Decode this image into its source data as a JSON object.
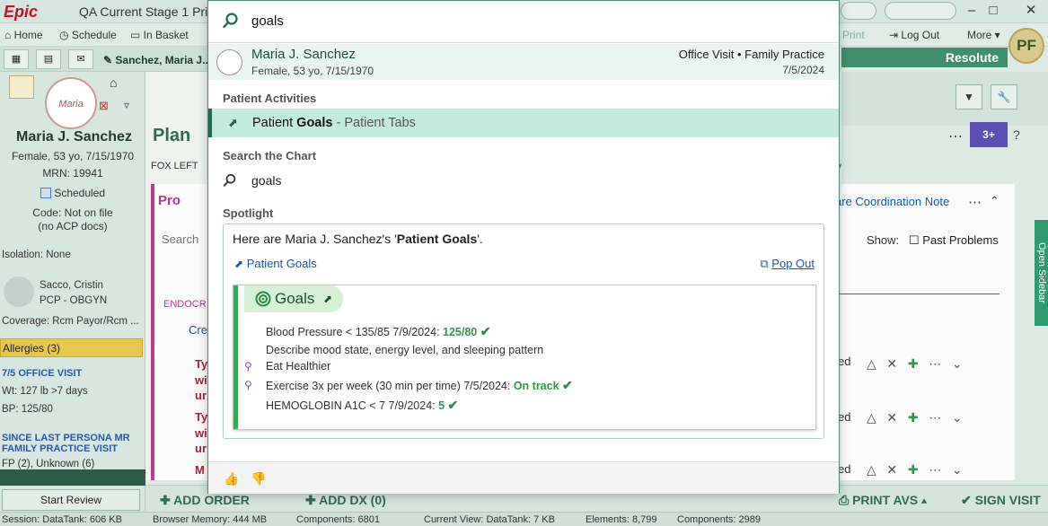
{
  "window": {
    "app_logo": "Epic",
    "title": "QA Current Stage 1 Prin"
  },
  "menubar": {
    "home": "Home",
    "schedule": "Schedule",
    "in_basket": "In Basket",
    "print": "Print",
    "log_out": "Log Out",
    "more": "More"
  },
  "user_initials": "PF",
  "patient_tab": "Sanchez, Maria J...",
  "resolute_label": "Resolute",
  "sidebar": {
    "name": "Maria J. Sanchez",
    "demographics": "Female, 53 yo, 7/15/1970",
    "mrn": "MRN: 19941",
    "scheduled": "Scheduled",
    "code_line1": "Code: Not on file",
    "code_line2": "(no ACP docs)",
    "isolation": "Isolation: None",
    "pcp_name": "Sacco, Cristin",
    "pcp_role": "PCP - OBGYN",
    "coverage": "Coverage: Rcm Payor/Rcm ...",
    "allergies": "Allergies (3)",
    "visit_header": "7/5 OFFICE VISIT",
    "weight": "Wt:  127 lb >7 days",
    "bp": "BP:  125/80",
    "since_line1": "SINCE LAST PERSONA MR",
    "since_line2": "FAMILY PRACTICE VISIT",
    "fp_line": "FP (2), Unknown (6)",
    "start_review": "Start Review"
  },
  "main": {
    "plan_title": "Plan",
    "fox_left": "FOX LEFT",
    "problem_partial": "Pro",
    "search_partial": "Search",
    "endocr_partial": "ENDOCR",
    "cre_partial": "Cre",
    "ty_partial": "Ty",
    "wi_partial": "wi",
    "ur_partial": "ur",
    "m_partial": "M",
    "care_coord": "are Coordination Note",
    "show_label": "Show:",
    "past_problems": "Past Problems",
    "open_sidebar": "Open Sidebar",
    "y_partial": "y",
    "ed_partial": "ed",
    "badge_count": "3+"
  },
  "bottombar": {
    "add_order": "ADD ORDER",
    "add_dx": "ADD DX (0)",
    "print_avs": "PRINT AVS",
    "sign_visit": "SIGN VISIT"
  },
  "statusbar": {
    "session": "Session:  DataTank: 606 KB",
    "browser_memory": "Browser Memory: 444 MB",
    "components": "Components: 6801",
    "current_view": "Current View:  DataTank: 7 KB",
    "elements": "Elements: 8,799",
    "components2": "Components: 2989"
  },
  "search": {
    "query": "goals",
    "patient": {
      "name": "Maria J. Sanchez",
      "details": "Female, 53 yo, 7/15/1970",
      "visit": "Office Visit • Family Practice",
      "date": "7/5/2024"
    },
    "patient_activities_label": "Patient Activities",
    "activity": {
      "prefix": "Patient ",
      "bold": "Goals",
      "suffix": " - Patient Tabs"
    },
    "search_chart_label": "Search the Chart",
    "chart_query": "goals",
    "spotlight_label": "Spotlight",
    "spotlight": {
      "intro": "Here are Maria J. Sanchez's '",
      "intro_bold": "Patient Goals",
      "intro_end": "'.",
      "link": "Patient Goals",
      "pop_out": "Pop Out",
      "card_title": "Goals",
      "goals": [
        {
          "text": "Blood Pressure < 135/85   7/9/2024: ",
          "value": "125/80",
          "check": "✔"
        },
        {
          "text": "Describe mood state, energy level, and sleeping pattern",
          "value": "",
          "check": ""
        },
        {
          "text": "Eat Healthier",
          "value": "",
          "check": ""
        },
        {
          "text": "Exercise 3x per week (30 min per time)   7/5/2024: ",
          "value": "On track",
          "check": "✔"
        },
        {
          "text": "HEMOGLOBIN A1C < 7   7/9/2024: ",
          "value": "5",
          "check": "✔"
        }
      ]
    }
  },
  "colors": {
    "accent": "#1e6a50",
    "highlight": "#c4eade",
    "goal_green": "#2c9a47",
    "link": "#1a56b0"
  }
}
